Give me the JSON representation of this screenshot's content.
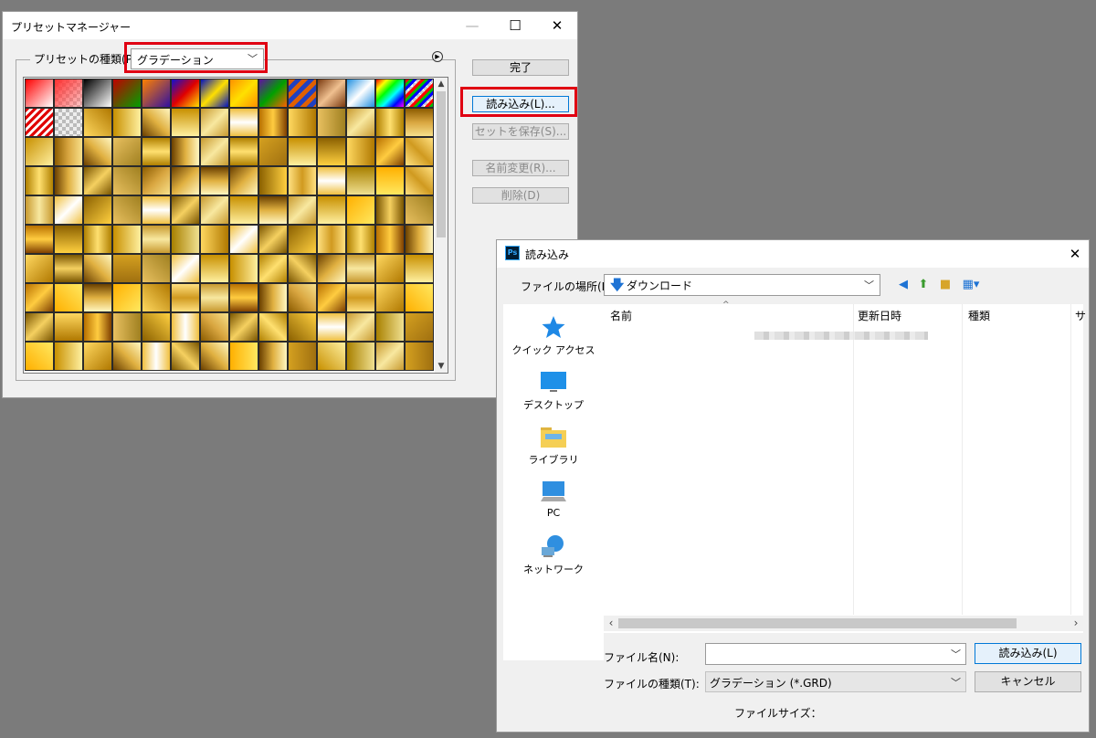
{
  "preset_manager": {
    "title": "プリセットマネージャー",
    "preset_type_label": "プリセットの種類(P)",
    "preset_type_value": "グラデーション",
    "buttons": {
      "done": "完了",
      "load": "読み込み(L)...",
      "save_set": "セットを保存(S)...",
      "rename": "名前変更(R)...",
      "delete": "削除(D)"
    },
    "highlight_color": "#e00012"
  },
  "load_dialog": {
    "title": "読み込み",
    "app_icon_text": "Ps",
    "look_in_label": "ファイルの場所(I):",
    "look_in_value": "ダウンロード",
    "places": [
      "クイック アクセス",
      "デスクトップ",
      "ライブラリ",
      "PC",
      "ネットワーク"
    ],
    "columns": [
      "名前",
      "更新日時",
      "種類",
      "サ"
    ],
    "file_name_label": "ファイル名(N):",
    "file_name_value": "",
    "file_type_label": "ファイルの種類(T):",
    "file_type_value": "グラデーション (*.GRD)",
    "open_button": "読み込み(L)",
    "cancel_button": "キャンセル",
    "file_size_label": "ファイルサイズ："
  }
}
